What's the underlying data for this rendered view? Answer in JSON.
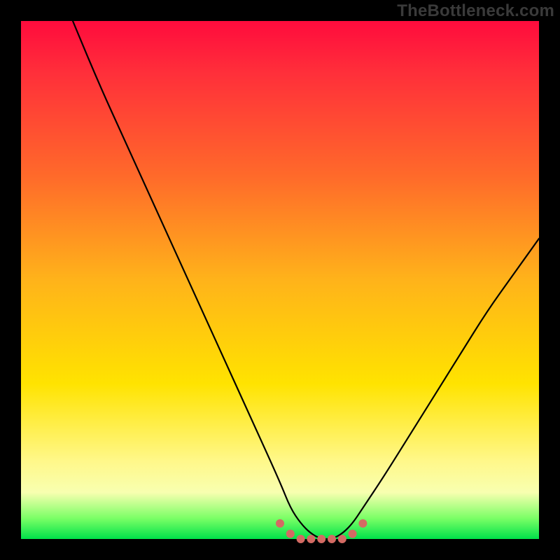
{
  "watermark": "TheBottleneck.com",
  "chart_data": {
    "type": "line",
    "title": "",
    "xlabel": "",
    "ylabel": "",
    "xlim": [
      0,
      100
    ],
    "ylim": [
      0,
      100
    ],
    "grid": false,
    "legend": false,
    "series": [
      {
        "name": "bottleneck-curve",
        "x": [
          10,
          15,
          20,
          25,
          30,
          35,
          40,
          45,
          50,
          52,
          54,
          56,
          58,
          60,
          62,
          64,
          66,
          70,
          75,
          80,
          85,
          90,
          95,
          100
        ],
        "values": [
          100,
          88,
          77,
          66,
          55,
          44,
          33,
          22,
          11,
          6,
          3,
          1,
          0,
          0,
          1,
          3,
          6,
          12,
          20,
          28,
          36,
          44,
          51,
          58
        ]
      }
    ],
    "marker_points": {
      "name": "trough-dots",
      "x": [
        50,
        52,
        54,
        56,
        58,
        60,
        62,
        64,
        66
      ],
      "values": [
        3,
        1,
        0,
        0,
        0,
        0,
        0,
        1,
        3
      ]
    },
    "background_gradient": {
      "stops": [
        {
          "pos": 0.0,
          "color": "#ff0b3d"
        },
        {
          "pos": 0.1,
          "color": "#ff2f3a"
        },
        {
          "pos": 0.3,
          "color": "#ff6a2a"
        },
        {
          "pos": 0.5,
          "color": "#ffb31a"
        },
        {
          "pos": 0.7,
          "color": "#ffe300"
        },
        {
          "pos": 0.85,
          "color": "#fff88a"
        },
        {
          "pos": 0.91,
          "color": "#f8ffb0"
        },
        {
          "pos": 0.96,
          "color": "#7bff66"
        },
        {
          "pos": 1.0,
          "color": "#00e24a"
        }
      ]
    }
  }
}
